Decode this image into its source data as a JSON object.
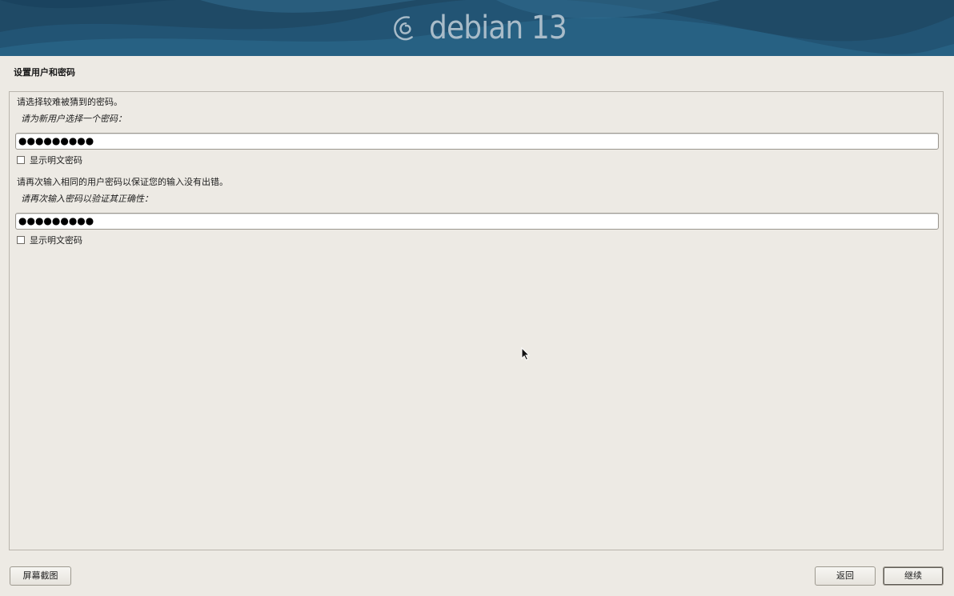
{
  "banner": {
    "wordmark": "debian 13"
  },
  "page_title": "设置用户和密码",
  "form": {
    "intro": "请选择较难被猜到的密码。",
    "password_prompt": "请为新用户选择一个密码：",
    "password_value": "●●●●●●●●●",
    "show_password_label_1": "显示明文密码",
    "confirm_intro": "请再次输入相同的用户密码以保证您的输入没有出错。",
    "confirm_prompt": "请再次输入密码以验证其正确性：",
    "confirm_value": "●●●●●●●●●",
    "show_password_label_2": "显示明文密码"
  },
  "buttons": {
    "screenshot": "屏幕截图",
    "back": "返回",
    "continue": "继续"
  },
  "colors": {
    "banner_bg": "#1f4a66",
    "wordmark": "#a9bcc9",
    "page_bg": "#edeae4"
  },
  "icons": {
    "logo": "debian-swirl-icon",
    "cursor": "mouse-pointer-icon"
  }
}
